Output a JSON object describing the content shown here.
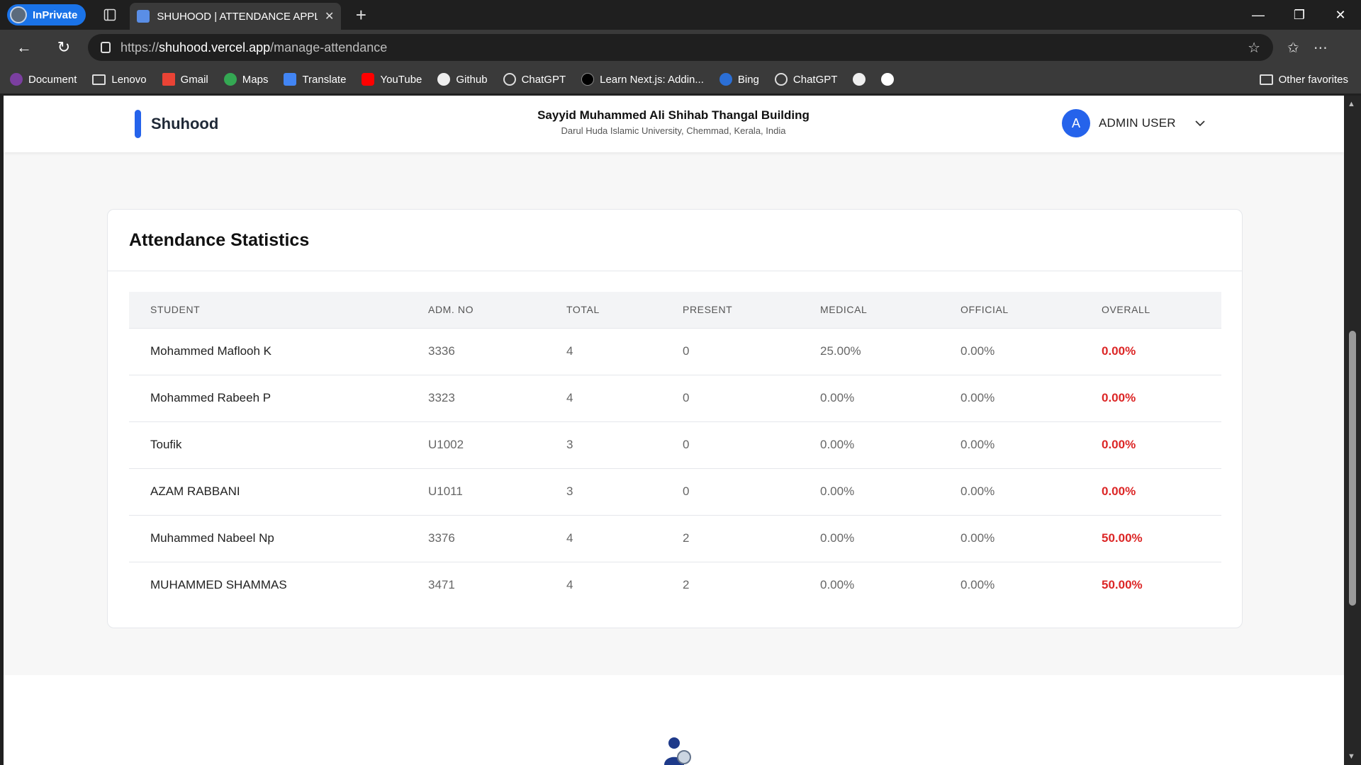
{
  "browser": {
    "inprivate_label": "InPrivate",
    "tab_title": "SHUHOOD | ATTENDANCE APPLIC",
    "url_prefix": "https://",
    "url_domain": "shuhood.vercel.app",
    "url_path": "/manage-attendance",
    "bookmarks": [
      "Document",
      "Lenovo",
      "Gmail",
      "Maps",
      "Translate",
      "YouTube",
      "Github",
      "ChatGPT",
      "Learn Next.js: Addin...",
      "Bing",
      "ChatGPT"
    ],
    "other_favorites": "Other favorites"
  },
  "header": {
    "brand": "Shuhood",
    "building": "Sayyid Muhammed Ali Shihab Thangal Building",
    "university": "Darul Huda Islamic University, Chemmad, Kerala, India",
    "avatar_letter": "A",
    "user_name": "ADMIN USER"
  },
  "stats": {
    "title": "Attendance Statistics",
    "columns": [
      "STUDENT",
      "ADM. NO",
      "TOTAL",
      "PRESENT",
      "MEDICAL",
      "OFFICIAL",
      "OVERALL"
    ],
    "rows": [
      {
        "student": "Mohammed Maflooh K",
        "adm": "3336",
        "total": "4",
        "present": "0",
        "medical": "25.00%",
        "official": "0.00%",
        "overall": "0.00%"
      },
      {
        "student": "Mohammed Rabeeh P",
        "adm": "3323",
        "total": "4",
        "present": "0",
        "medical": "0.00%",
        "official": "0.00%",
        "overall": "0.00%"
      },
      {
        "student": "Toufik",
        "adm": "U1002",
        "total": "3",
        "present": "0",
        "medical": "0.00%",
        "official": "0.00%",
        "overall": "0.00%"
      },
      {
        "student": "AZAM RABBANI",
        "adm": "U1011",
        "total": "3",
        "present": "0",
        "medical": "0.00%",
        "official": "0.00%",
        "overall": "0.00%"
      },
      {
        "student": "Muhammed Nabeel Np",
        "adm": "3376",
        "total": "4",
        "present": "2",
        "medical": "0.00%",
        "official": "0.00%",
        "overall": "50.00%"
      },
      {
        "student": "MUHAMMED SHAMMAS",
        "adm": "3471",
        "total": "4",
        "present": "2",
        "medical": "0.00%",
        "official": "0.00%",
        "overall": "50.00%"
      }
    ]
  },
  "colors": {
    "accent": "#2563eb",
    "overall_text": "#dc2626"
  }
}
